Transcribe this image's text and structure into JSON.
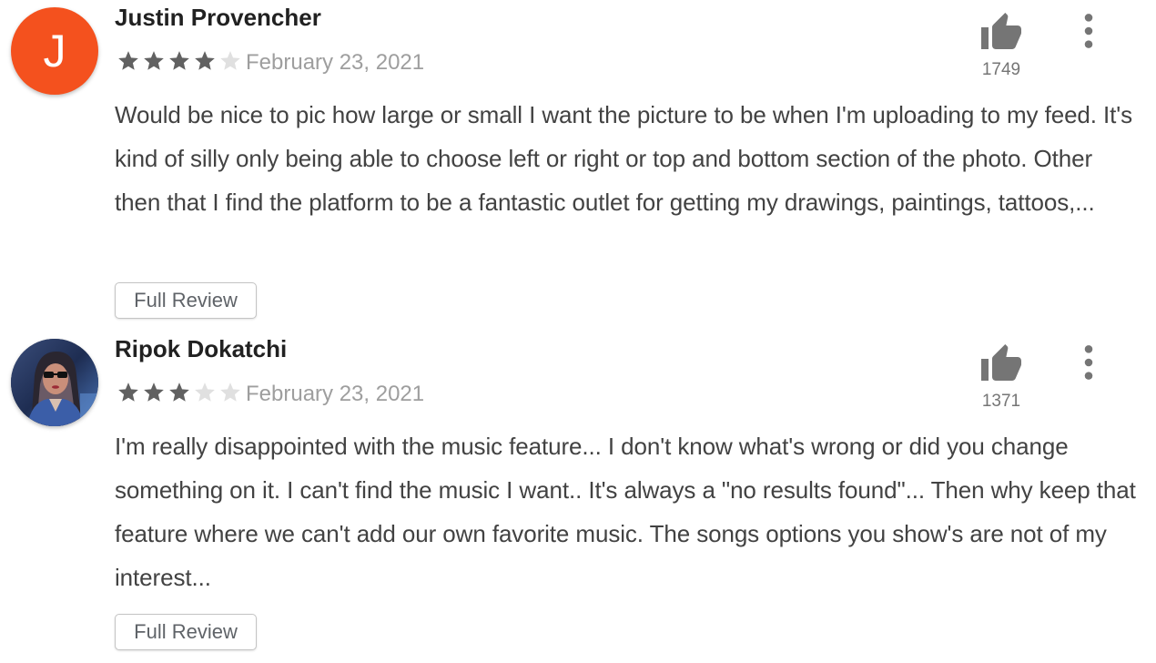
{
  "reviews": [
    {
      "avatar_letter": "J",
      "avatar_color": "#f4511e",
      "name": "Justin Provencher",
      "rating": 4,
      "date": "February 23, 2021",
      "text": "Would be nice to pic how large or small I want the picture to be when I'm uploading to my feed. It's kind of silly only being able to choose left or right or top and bottom section of the photo. Other then that I find the platform to be a fantastic outlet for getting my drawings, paintings, tattoos,...",
      "full_review_label": "Full Review",
      "helpful_count": "1749"
    },
    {
      "avatar_letter": "",
      "avatar_color": "#1c2a4a",
      "name": "Ripok Dokatchi",
      "rating": 3,
      "date": "February 23, 2021",
      "text": "I'm really disappointed with the music feature... I don't know what's wrong or did you change something on it. I can't find the music I want.. It's always a \"no results found\"... Then why keep that feature where we can't add our own favorite music. The songs options you show's are not of my interest...",
      "full_review_label": "Full Review",
      "helpful_count": "1371"
    }
  ],
  "colors": {
    "star_filled": "#616161",
    "star_empty": "#e0e0e0",
    "icon": "#757575"
  },
  "icons": {
    "helpful": "thumb-up-icon",
    "more": "more-vert-icon",
    "star": "star-icon"
  }
}
